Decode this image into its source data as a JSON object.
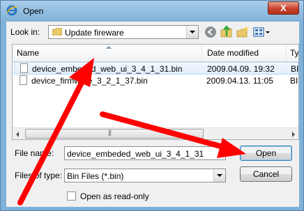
{
  "window": {
    "title": "Open",
    "close_glyph": "X"
  },
  "toolbar": {
    "look_in_label": "Look in:",
    "look_in_value": "Update fireware",
    "icons": [
      "back-icon",
      "up-folder-icon",
      "new-folder-icon",
      "view-menu-icon"
    ]
  },
  "list": {
    "columns": [
      "Name",
      "Date modified",
      "Ty"
    ],
    "files": [
      {
        "name": "device_embeded_web_ui_3_4_1_31.bin",
        "date": "2009.04.09. 19:32",
        "type": "BI"
      },
      {
        "name": "device_firmware_3_2_1_37.bin",
        "date": "2009.04.13. 11:05",
        "type": "BI"
      }
    ]
  },
  "form": {
    "file_name_label": "File name:",
    "file_name_value": "device_embeded_web_ui_3_4_1_31",
    "file_type_label": "Files of type:",
    "file_type_value": "Bin Files (*.bin)",
    "readonly_label": "Open as read-only"
  },
  "buttons": {
    "open": "Open",
    "cancel": "Cancel"
  },
  "colors": {
    "annotation_arrow": "#ff0000",
    "selection": "#e2eefa",
    "titlebar": "#7fb1d8"
  }
}
